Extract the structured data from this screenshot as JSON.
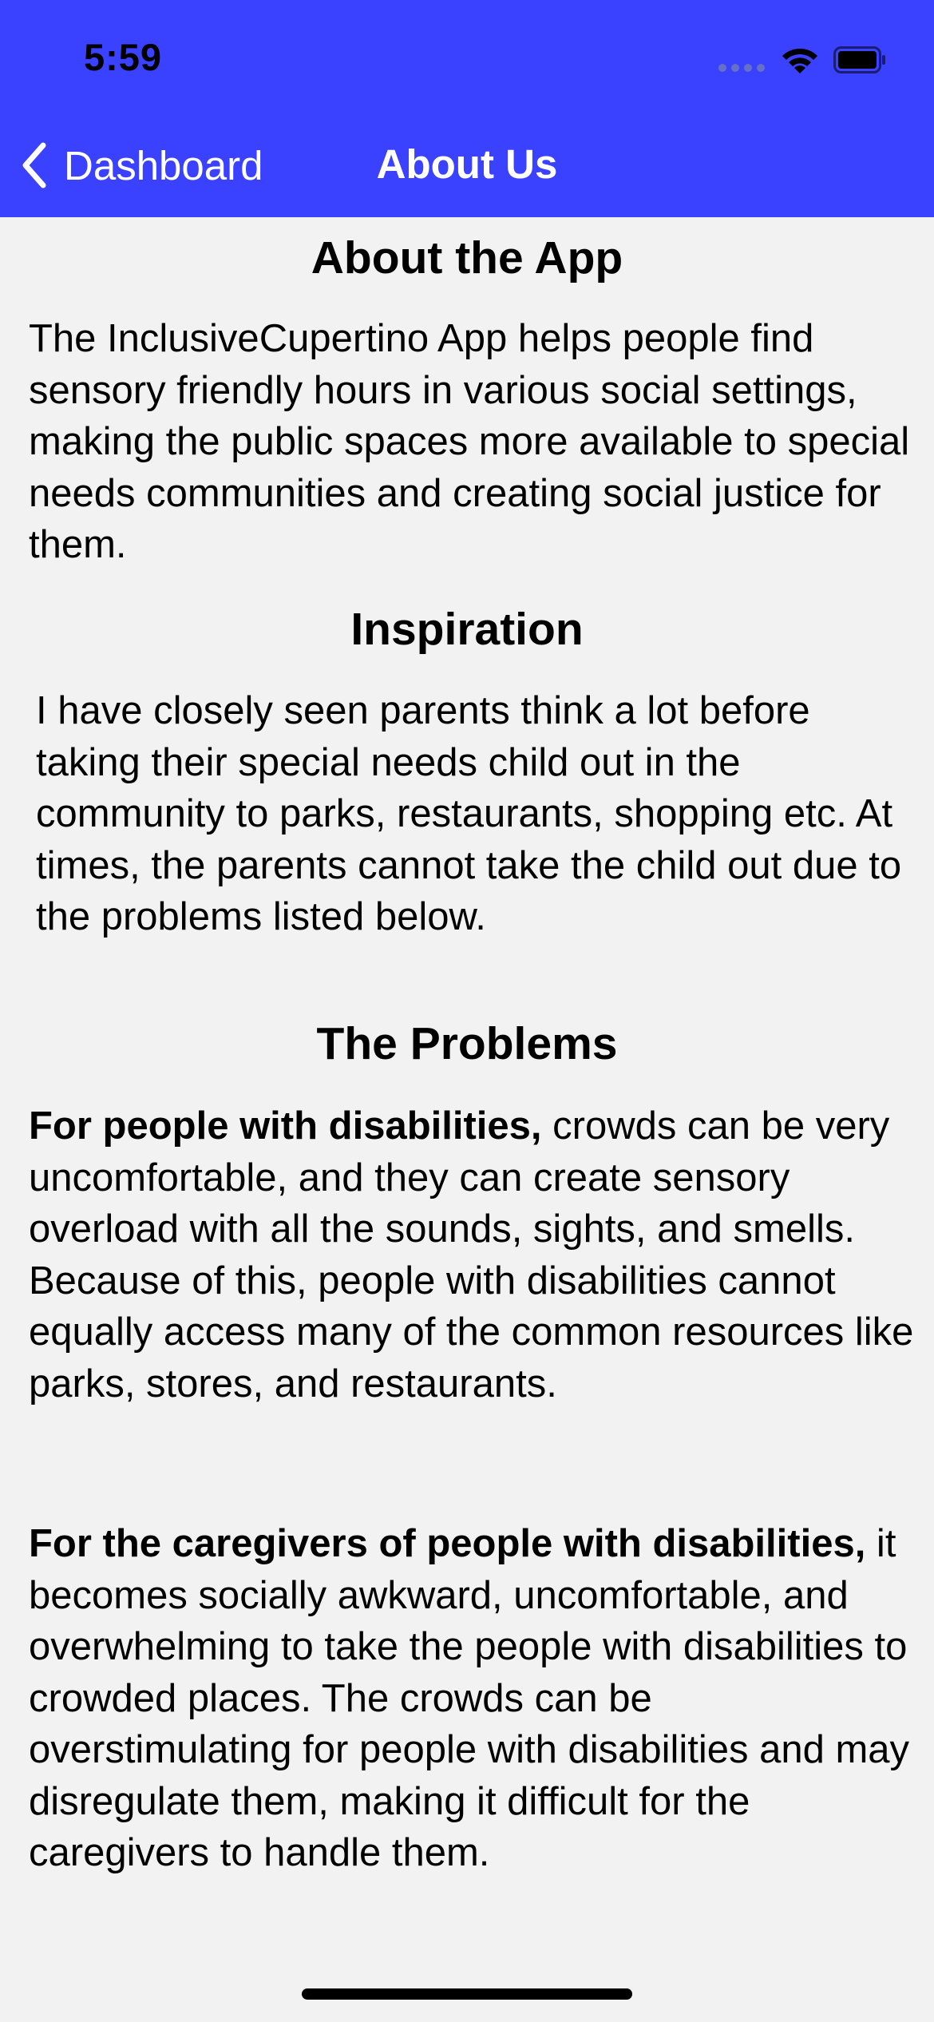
{
  "status_bar": {
    "time": "5:59",
    "icons": [
      "signal-icon",
      "wifi-icon",
      "battery-icon"
    ]
  },
  "nav": {
    "back_label": "Dashboard",
    "back_icon": "chevron-left-icon",
    "title": "About Us"
  },
  "sections": {
    "about": {
      "heading": "About the App",
      "body": "The InclusiveCupertino App helps people find sensory friendly hours in various social settings, making the public spaces more available to special needs communities and creating social justice for them."
    },
    "inspiration": {
      "heading": "Inspiration",
      "body": "I have closely seen parents think a lot before taking their special needs child out in the community to parks, restaurants, shopping etc. At times, the parents cannot take the child out due to the problems listed below."
    },
    "problems": {
      "heading": "The Problems",
      "items": [
        {
          "lead": "For people with disabilities,",
          "text": " crowds can be very uncomfortable, and they can create sensory overload with all the sounds, sights, and smells. Because of this, people with disabilities cannot equally access many of the common resources like parks, stores, and restaurants."
        },
        {
          "lead": "For the caregivers of people with disabilities,",
          "text": " it becomes socially awkward, uncomfortable, and overwhelming to take the people with disabilities to crowded places. The crowds can be overstimulating for people with disabilities and may disregulate them, making it difficult for the caregivers to handle them."
        }
      ]
    }
  },
  "colors": {
    "header_bg": "#3a42ff",
    "page_bg": "#f2f2f2",
    "header_text": "#ffffff"
  }
}
